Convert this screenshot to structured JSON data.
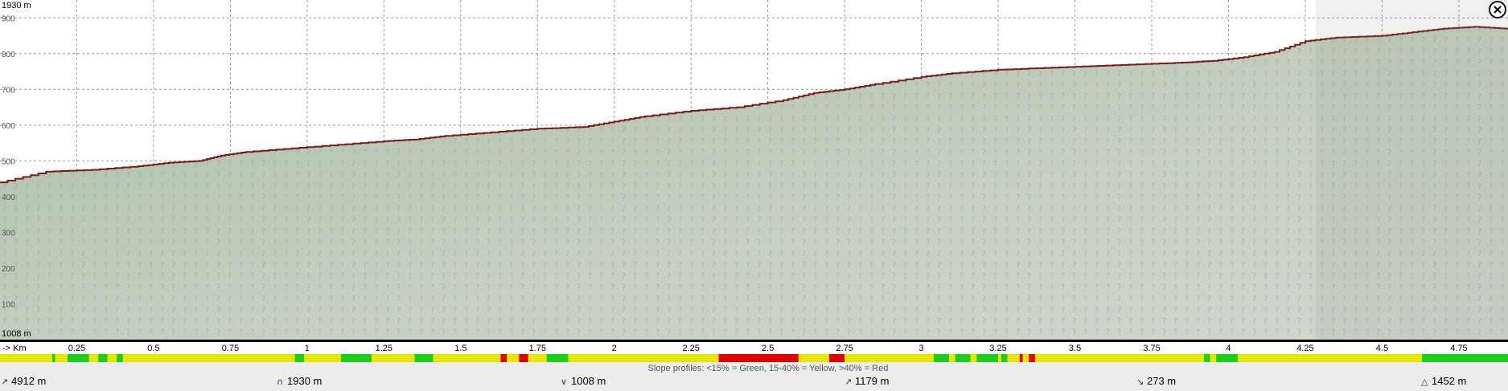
{
  "chart_data": {
    "type": "area",
    "y_top_label": "1930 m",
    "y_bottom_label": "1008 m",
    "y_ticks": [
      {
        "label": "900",
        "value": 900
      },
      {
        "label": "800",
        "value": 800
      },
      {
        "label": "700",
        "value": 700
      },
      {
        "label": "600",
        "value": 600
      },
      {
        "label": "500",
        "value": 500
      },
      {
        "label": "400",
        "value": 400
      },
      {
        "label": "300",
        "value": 300
      },
      {
        "label": "200",
        "value": 200
      },
      {
        "label": "100",
        "value": 100
      }
    ],
    "ylim": [
      0,
      950
    ],
    "xlim": [
      0,
      4.91
    ],
    "x_unit_label": "-> Km",
    "x_ticks": [
      "0.25",
      "0.5",
      "0.75",
      "1",
      "1.25",
      "1.5",
      "1.75",
      "2",
      "2.25",
      "2.5",
      "2.75",
      "3",
      "3.25",
      "3.5",
      "3.75",
      "4",
      "4.25",
      "4.5",
      "4.75"
    ],
    "profile": {
      "x": [
        0,
        0.15,
        0.3,
        0.45,
        0.55,
        0.65,
        0.72,
        0.8,
        0.95,
        1.1,
        1.25,
        1.35,
        1.45,
        1.6,
        1.75,
        1.9,
        2.0,
        2.1,
        2.25,
        2.4,
        2.55,
        2.65,
        2.75,
        2.85,
        3.0,
        3.1,
        3.25,
        3.4,
        3.55,
        3.7,
        3.85,
        3.95,
        4.05,
        4.15,
        4.25,
        4.35,
        4.5,
        4.6,
        4.7,
        4.8,
        4.9
      ],
      "y": [
        440,
        470,
        475,
        485,
        495,
        500,
        515,
        525,
        535,
        545,
        555,
        560,
        570,
        580,
        590,
        595,
        610,
        625,
        640,
        650,
        670,
        690,
        700,
        715,
        735,
        745,
        755,
        760,
        765,
        770,
        775,
        780,
        790,
        805,
        835,
        845,
        850,
        860,
        870,
        875,
        870
      ]
    },
    "slope_legend": "Slope profiles: <15% = Green, 15-40% = Yellow, >40% = Red",
    "slope_colors": {
      "green": "#1ccf1c",
      "yellow": "#e6e600",
      "red": "#e00000"
    },
    "slope_segments": [
      {
        "from": 0,
        "to": 0.17,
        "c": "yellow"
      },
      {
        "from": 0.17,
        "to": 0.18,
        "c": "green"
      },
      {
        "from": 0.18,
        "to": 0.22,
        "c": "yellow"
      },
      {
        "from": 0.22,
        "to": 0.29,
        "c": "green"
      },
      {
        "from": 0.29,
        "to": 0.32,
        "c": "yellow"
      },
      {
        "from": 0.32,
        "to": 0.35,
        "c": "green"
      },
      {
        "from": 0.35,
        "to": 0.38,
        "c": "yellow"
      },
      {
        "from": 0.38,
        "to": 0.4,
        "c": "green"
      },
      {
        "from": 0.4,
        "to": 0.96,
        "c": "yellow"
      },
      {
        "from": 0.96,
        "to": 0.99,
        "c": "green"
      },
      {
        "from": 0.99,
        "to": 1.11,
        "c": "yellow"
      },
      {
        "from": 1.11,
        "to": 1.21,
        "c": "green"
      },
      {
        "from": 1.21,
        "to": 1.35,
        "c": "yellow"
      },
      {
        "from": 1.35,
        "to": 1.41,
        "c": "green"
      },
      {
        "from": 1.41,
        "to": 1.63,
        "c": "yellow"
      },
      {
        "from": 1.63,
        "to": 1.65,
        "c": "red"
      },
      {
        "from": 1.65,
        "to": 1.69,
        "c": "yellow"
      },
      {
        "from": 1.69,
        "to": 1.72,
        "c": "red"
      },
      {
        "from": 1.72,
        "to": 1.78,
        "c": "yellow"
      },
      {
        "from": 1.78,
        "to": 1.85,
        "c": "green"
      },
      {
        "from": 1.85,
        "to": 2.34,
        "c": "yellow"
      },
      {
        "from": 2.34,
        "to": 2.6,
        "c": "red"
      },
      {
        "from": 2.6,
        "to": 2.7,
        "c": "yellow"
      },
      {
        "from": 2.7,
        "to": 2.75,
        "c": "red"
      },
      {
        "from": 2.75,
        "to": 3.04,
        "c": "yellow"
      },
      {
        "from": 3.04,
        "to": 3.09,
        "c": "green"
      },
      {
        "from": 3.09,
        "to": 3.11,
        "c": "yellow"
      },
      {
        "from": 3.11,
        "to": 3.16,
        "c": "green"
      },
      {
        "from": 3.16,
        "to": 3.18,
        "c": "yellow"
      },
      {
        "from": 3.18,
        "to": 3.25,
        "c": "green"
      },
      {
        "from": 3.25,
        "to": 3.26,
        "c": "yellow"
      },
      {
        "from": 3.26,
        "to": 3.28,
        "c": "green"
      },
      {
        "from": 3.28,
        "to": 3.32,
        "c": "yellow"
      },
      {
        "from": 3.32,
        "to": 3.33,
        "c": "red"
      },
      {
        "from": 3.33,
        "to": 3.35,
        "c": "yellow"
      },
      {
        "from": 3.35,
        "to": 3.37,
        "c": "red"
      },
      {
        "from": 3.37,
        "to": 3.92,
        "c": "yellow"
      },
      {
        "from": 3.92,
        "to": 3.94,
        "c": "green"
      },
      {
        "from": 3.94,
        "to": 3.96,
        "c": "yellow"
      },
      {
        "from": 3.96,
        "to": 4.03,
        "c": "green"
      },
      {
        "from": 4.03,
        "to": 4.63,
        "c": "yellow"
      },
      {
        "from": 4.63,
        "to": 4.91,
        "c": "green"
      }
    ],
    "stats": [
      {
        "icon": "distance-icon",
        "label": "4912 m"
      },
      {
        "icon": "max-altitude-icon",
        "label": "1930 m"
      },
      {
        "icon": "min-altitude-icon",
        "label": "1008 m"
      },
      {
        "icon": "ascent-icon",
        "label": "1179 m"
      },
      {
        "icon": "descent-icon",
        "label": "273 m"
      },
      {
        "icon": "altitude-gain-icon",
        "label": "1452 m"
      }
    ]
  }
}
